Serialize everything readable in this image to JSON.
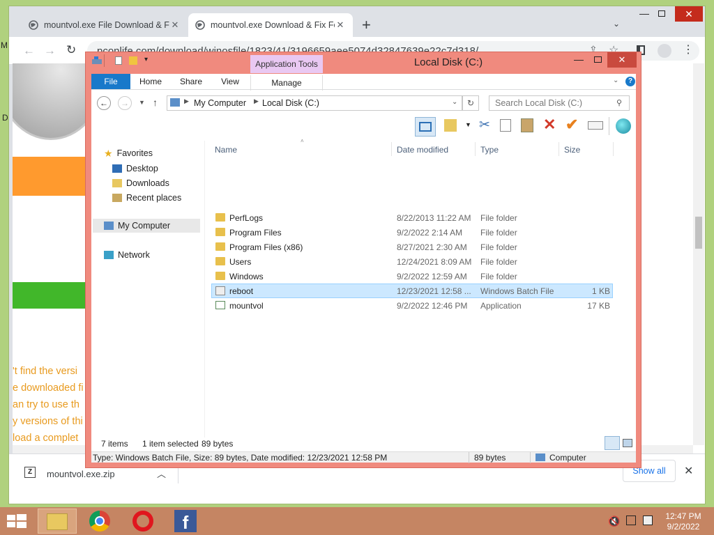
{
  "browser": {
    "tabs": [
      {
        "title": "mountvol.exe File Download & Fi"
      },
      {
        "title": "mountvol.exe Download & Fix Fo"
      }
    ],
    "new_tab": "+",
    "url": "pconlife.com/download/winosfile/1823/41/3196659aee5074d32847639e22c7d318/",
    "page_text": [
      "'t find the versi",
      "e downloaded fi",
      "an try to use th",
      "y versions of thi",
      "load a complet"
    ],
    "download": {
      "filename": "mountvol.exe.zip",
      "show_all": "Show all"
    }
  },
  "explorer": {
    "title": "Local Disk (C:)",
    "context_tab": "Application Tools",
    "ribbon_tabs": [
      "File",
      "Home",
      "Share",
      "View",
      "Manage"
    ],
    "breadcrumb": [
      "My Computer",
      "Local Disk (C:)"
    ],
    "search_placeholder": "Search Local Disk (C:)",
    "nav": {
      "favorites": "Favorites",
      "fav_items": [
        "Desktop",
        "Downloads",
        "Recent places"
      ],
      "computer": "My Computer",
      "network": "Network"
    },
    "columns": [
      "Name",
      "Date modified",
      "Type",
      "Size"
    ],
    "files": [
      {
        "name": "PerfLogs",
        "date": "8/22/2013 11:22 AM",
        "type": "File folder",
        "size": ""
      },
      {
        "name": "Program Files",
        "date": "9/2/2022 2:14 AM",
        "type": "File folder",
        "size": ""
      },
      {
        "name": "Program Files (x86)",
        "date": "8/27/2021 2:30 AM",
        "type": "File folder",
        "size": ""
      },
      {
        "name": "Users",
        "date": "12/24/2021 8:09 AM",
        "type": "File folder",
        "size": ""
      },
      {
        "name": "Windows",
        "date": "9/2/2022 12:59 AM",
        "type": "File folder",
        "size": ""
      },
      {
        "name": "reboot",
        "date": "12/23/2021 12:58 ...",
        "type": "Windows Batch File",
        "size": "1 KB"
      },
      {
        "name": "mountvol",
        "date": "9/2/2022 12:46 PM",
        "type": "Application",
        "size": "17 KB"
      }
    ],
    "status": {
      "items": "7 items",
      "selected": "1 item selected",
      "bytes": "89 bytes"
    },
    "details_bar": {
      "info": "Type: Windows Batch File, Size: 89 bytes, Date modified: 12/23/2021 12:58 PM",
      "size": "89 bytes",
      "location": "Computer"
    }
  },
  "taskbar": {
    "time": "12:47 PM",
    "date": "9/2/2022"
  },
  "desktop_letters": [
    "M",
    "D"
  ],
  "colors": {
    "selected_row": "#cce8ff",
    "window_frame": "#f08a7e",
    "taskbar": "#c58563",
    "accent_file": "#1979ca"
  }
}
